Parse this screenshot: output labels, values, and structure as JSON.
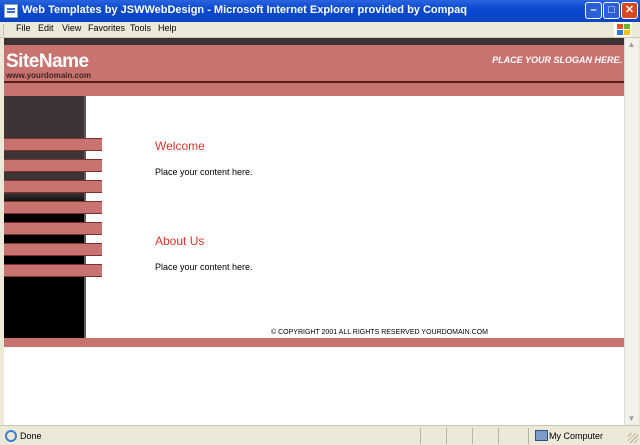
{
  "window": {
    "title": "Web Templates by JSWWebDesign - Microsoft Internet Explorer provided by Compaq",
    "minimize_label": "–",
    "maximize_label": "□",
    "close_label": "✕"
  },
  "menu": {
    "items": [
      "File",
      "Edit",
      "View",
      "Favorites",
      "Tools",
      "Help"
    ]
  },
  "site": {
    "name": "SiteName",
    "domain": "www.yourdomain.com",
    "slogan": "PLACE YOUR SLOGAN HERE.",
    "nav_items": [
      "",
      "",
      "",
      "",
      "",
      "",
      ""
    ],
    "sections": [
      {
        "heading": "Welcome",
        "body": "Place your content here."
      },
      {
        "heading": "About Us",
        "body": "Place your content here."
      }
    ],
    "copyright": "© COPYRIGHT 2001 ALL RIGHTS RESERVED YOURDOMAIN.COM",
    "colors": {
      "primary": "#c97370",
      "dark": "#3e3435",
      "heading": "#d9332a"
    }
  },
  "status": {
    "text": "Done",
    "zone": "My Computer"
  },
  "icons": [
    "ie-app-icon",
    "windows-logo-icon",
    "ie-status-icon",
    "computer-icon"
  ]
}
